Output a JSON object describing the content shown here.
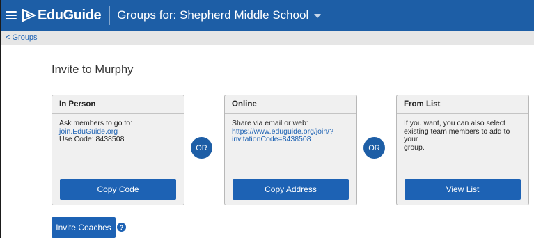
{
  "header": {
    "logo_text": "EduGuide",
    "group_selector": "Groups for: Shepherd Middle School"
  },
  "breadcrumb": {
    "back_link": "< Groups"
  },
  "page": {
    "title": "Invite to Murphy"
  },
  "cards": {
    "in_person": {
      "title": "In Person",
      "line1": "Ask members to go to:",
      "link": "join.EduGuide.org",
      "line3": "Use Code: 8438508",
      "button": "Copy Code"
    },
    "online": {
      "title": "Online",
      "line1": "Share via email or web:",
      "link_line1": "https://www.eduguide.org/join/?",
      "link_line2": "invitationCode=8438508",
      "button": "Copy Address"
    },
    "from_list": {
      "title": "From List",
      "line1": "If you want, you can also select",
      "line2": "existing team members to add to your",
      "line3": "group.",
      "button": "View List"
    }
  },
  "or_label": "OR",
  "invite_coaches": {
    "label": "Invite Coaches",
    "help_glyph": "?"
  },
  "colors": {
    "header_bg": "#1d5ea6",
    "button_bg": "#1d62b4",
    "link": "#1d62b4",
    "card_bg": "#f0f0f0"
  },
  "icons": [
    "menu-icon",
    "eduguide-logo-icon",
    "chevron-down-icon",
    "help-icon"
  ]
}
